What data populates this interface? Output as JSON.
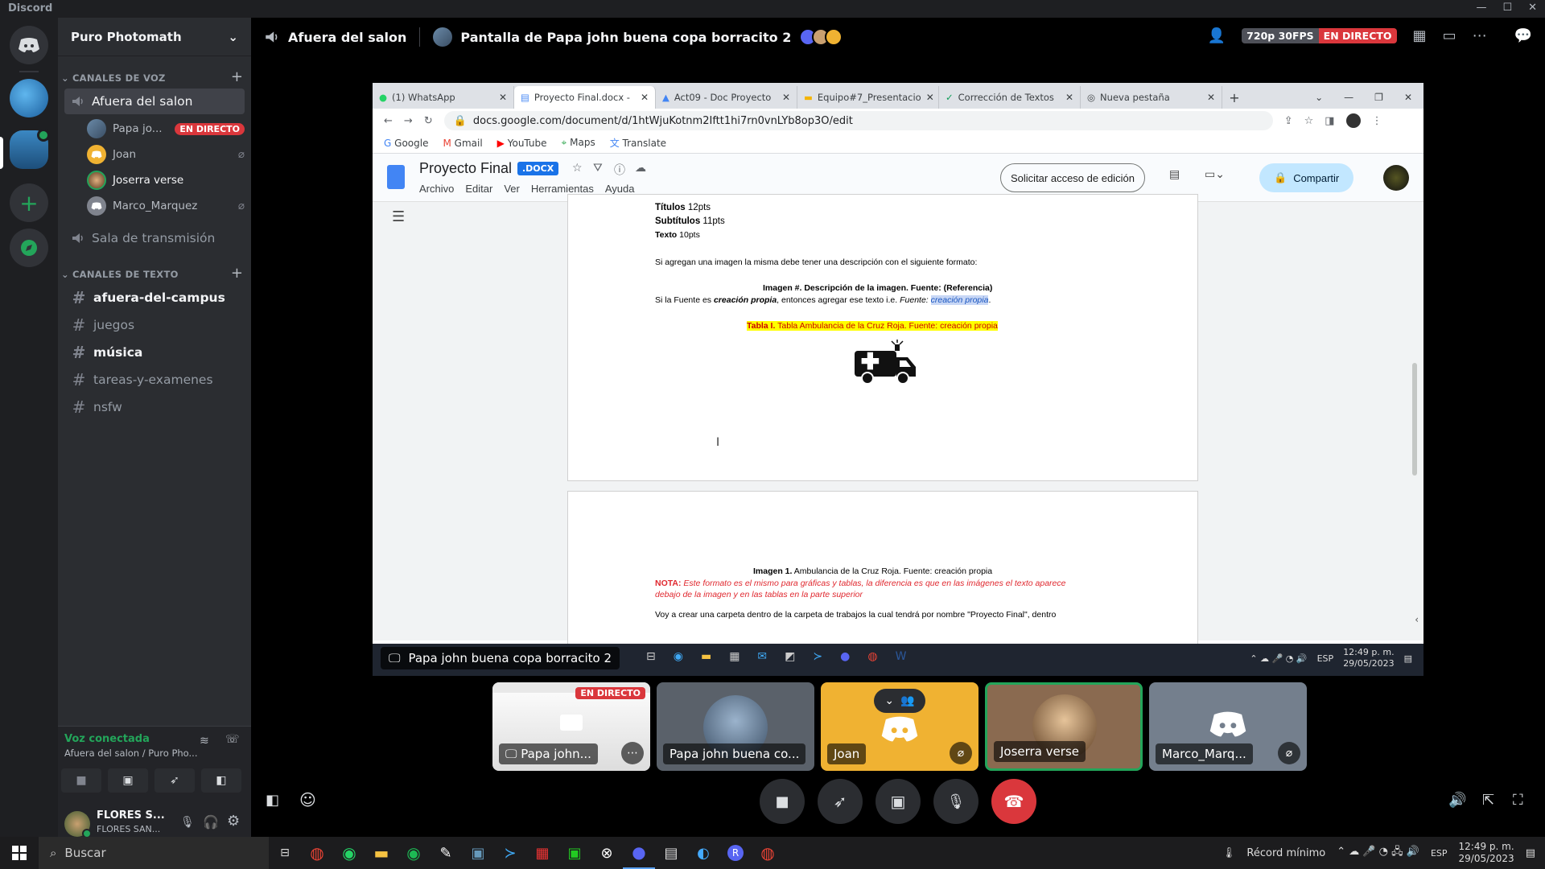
{
  "window": {
    "title": "Discord"
  },
  "server": {
    "name": "Puro Photomath"
  },
  "voice_category": "CANALES DE VOZ",
  "text_category": "CANALES DE TEXTO",
  "voice_channels": [
    {
      "name": "Afuera del salon"
    },
    {
      "name": "Sala de transmisión"
    }
  ],
  "voice_users": [
    {
      "name": "Papa jo...",
      "badge": "EN DIRECTO"
    },
    {
      "name": "Joan"
    },
    {
      "name": "Joserra verse"
    },
    {
      "name": "Marco_Marquez"
    }
  ],
  "text_channels": [
    {
      "name": "afuera-del-campus"
    },
    {
      "name": "juegos"
    },
    {
      "name": "música"
    },
    {
      "name": "tareas-y-examenes"
    },
    {
      "name": "nsfw"
    }
  ],
  "voice_panel": {
    "status": "Voz conectada",
    "location": "Afuera del salon / Puro Pho..."
  },
  "user": {
    "name": "FLORES S...",
    "sub": "FLORES SAN..."
  },
  "header": {
    "channel": "Afuera del salon",
    "stream_title": "Pantalla de Papa john buena copa borracito 2",
    "quality": "720p 30FPS",
    "live": "EN DIRECTO"
  },
  "browser": {
    "tabs": [
      {
        "title": "(1) WhatsApp"
      },
      {
        "title": "Proyecto Final.docx -"
      },
      {
        "title": "Act09 - Doc Proyecto"
      },
      {
        "title": "Equipo#7_Presentacio"
      },
      {
        "title": "Corrección de Textos"
      },
      {
        "title": "Nueva pestaña"
      }
    ],
    "url": "docs.google.com/document/d/1htWjuKotnm2Iftt1hi7rn0vnLYb8op3O/edit",
    "bookmarks": [
      "Google",
      "Gmail",
      "YouTube",
      "Maps",
      "Translate"
    ]
  },
  "doc": {
    "title": "Proyecto Final",
    "ext": ".DOCX",
    "menu": [
      "Archivo",
      "Editar",
      "Ver",
      "Herramientas",
      "Ayuda"
    ],
    "request_edit": "Solicitar acceso de edición",
    "share": "Compartir",
    "lines": {
      "titulos": "Títulos",
      "titulos_val": "12pts",
      "subtitulos": "Subtítulos",
      "subtitulos_val": "11pts",
      "texto": "Texto",
      "texto_val": "10pts",
      "img_rule": "Si agregan una imagen la misma debe tener una descripción con el siguiente formato:",
      "img_format": "Imagen #. Descripción de la imagen. Fuente: (Referencia)",
      "fuente_a": "Si la Fuente es",
      "fuente_b": "creación propia",
      "fuente_c": ", entonces agregar ese texto i.e.",
      "fuente_d": "Fuente:",
      "fuente_e": "creación propia",
      "tabla_a": "Tabla I.",
      "tabla_b": "Tabla Ambulancia de la Cruz Roja. Fuente: creación propia",
      "imagen1_a": "Imagen 1.",
      "imagen1_b": "Ambulancia de la Cruz Roja. Fuente: creación propia",
      "nota_a": "NOTA:",
      "nota_b": "Este formato es el mismo para gráficas y tablas, la diferencia es que en las imágenes el texto aparece",
      "nota_c": "debajo de la imagen y en las tablas en la parte superior",
      "carpeta": "Voy a crear una carpeta dentro de la carpeta de trabajos la cual tendrá por nombre \"Proyecto Final\", dentro"
    }
  },
  "inner_taskbar": {
    "stream_label": "Papa john buena copa borracito 2",
    "lang": "ESP",
    "time": "12:49 p. m.",
    "date": "29/05/2023"
  },
  "tiles": [
    {
      "label": "Papa john...",
      "badge": "EN DIRECTO"
    },
    {
      "label": "Papa john buena co..."
    },
    {
      "label": "Joan"
    },
    {
      "label": "Joserra verse"
    },
    {
      "label": "Marco_Marq..."
    }
  ],
  "taskbar": {
    "search": "Buscar",
    "record": "Récord mínimo",
    "lang": "ESP",
    "time": "12:49 p. m.",
    "date": "29/05/2023"
  },
  "colors": {
    "blurple": "#5865f2",
    "live_red": "#da373c",
    "green": "#23a55a",
    "joan_orange": "#f0b232"
  }
}
